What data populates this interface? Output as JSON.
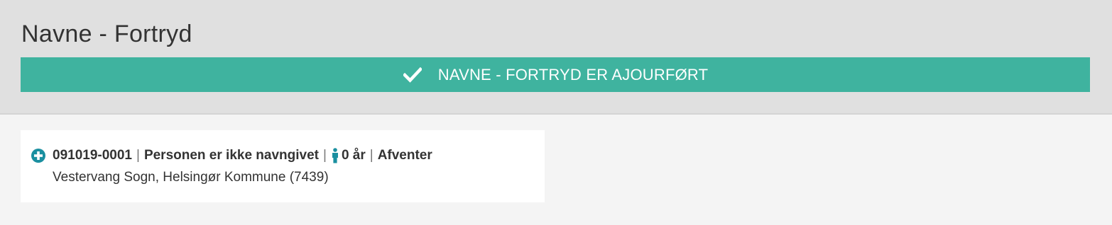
{
  "header": {
    "title": "Navne - Fortryd",
    "banner": {
      "message": "NAVNE - FORTRYD ER AJOURFØRT",
      "icon": "checkmark-icon",
      "color": "#3fb39f"
    }
  },
  "record": {
    "expand_icon": "plus-circle-icon",
    "id": "091019-0001",
    "name": "Personen er ikke navngivet",
    "gender_icon": "male-person-icon",
    "age": "0 år",
    "status": "Afventer",
    "location": "Vestervang Sogn, Helsingør Kommune (7439)",
    "icon_color": "#1a8fa0"
  }
}
